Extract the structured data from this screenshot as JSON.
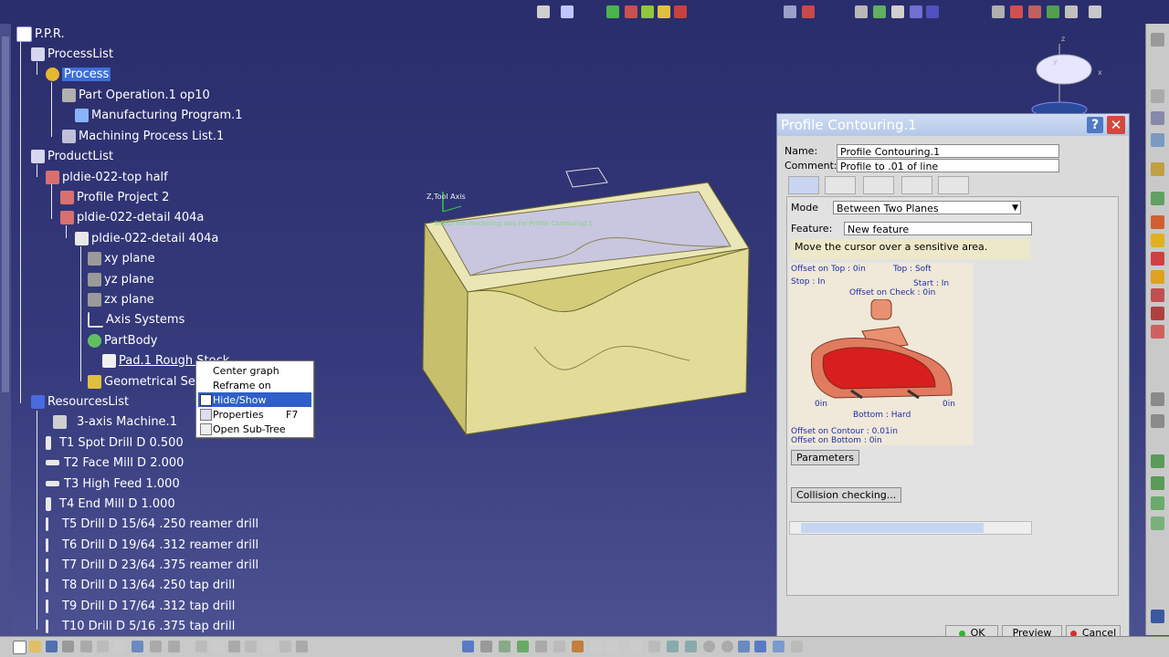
{
  "tree": {
    "root": "P.P.R.",
    "items": [
      {
        "label": "ProcessList"
      },
      {
        "label": "Process"
      },
      {
        "label": "Part Operation.1 op10"
      },
      {
        "label": "Manufacturing Program.1"
      },
      {
        "label": "Machining Process List.1"
      },
      {
        "label": "ProductList"
      },
      {
        "label": "pldie-022-top half"
      },
      {
        "label": "Profile Project 2"
      },
      {
        "label": "pldie-022-detail 404a"
      },
      {
        "label": "pldie-022-detail 404a"
      },
      {
        "label": "xy plane"
      },
      {
        "label": "yz plane"
      },
      {
        "label": "zx plane"
      },
      {
        "label": "Axis Systems"
      },
      {
        "label": "PartBody"
      },
      {
        "label": "Pad.1 Rough Stock"
      },
      {
        "label": "Geometrical Set"
      },
      {
        "label": "ResourcesList"
      },
      {
        "label": "3-axis Machine.1"
      },
      {
        "label": "T1 Spot Drill D 0.500"
      },
      {
        "label": "T2 Face Mill D 2.000"
      },
      {
        "label": "T3 High Feed 1.000"
      },
      {
        "label": "T4 End Mill D 1.000"
      },
      {
        "label": "T5 Drill D 15/64 .250 reamer drill"
      },
      {
        "label": "T6 Drill D 19/64 .312 reamer drill"
      },
      {
        "label": "T7 Drill D 23/64 .375 reamer drill"
      },
      {
        "label": "T8 Drill D 13/64 .250 tap drill"
      },
      {
        "label": "T9 Drill D 17/64 .312 tap drill"
      },
      {
        "label": "T10 Drill D 5/16 .375 tap drill"
      }
    ]
  },
  "context_menu": {
    "items": [
      {
        "label": "Center graph",
        "key": ""
      },
      {
        "label": "Reframe on",
        "key": ""
      },
      {
        "label": "Hide/Show",
        "key": ""
      },
      {
        "label": "Properties",
        "key": "F7"
      },
      {
        "label": "Open Sub-Tree",
        "key": ""
      }
    ]
  },
  "viewport": {
    "tool_axis_label": "Z,Tool Axis",
    "axis_note": "Select the machining axis for Profile Contouring.1",
    "compass_z": "z",
    "compass_x": "x",
    "compass_y": "y"
  },
  "dialog": {
    "title": "Profile Contouring.1",
    "help": "?",
    "close": "✕",
    "name_label": "Name:",
    "name_value": "Profile Contouring.1",
    "comment_label": "Comment:",
    "comment_value": "Profile to .01 of line",
    "mode_label": "Mode",
    "mode_value": "Between Two Planes",
    "feature_label": "Feature:",
    "feature_value": "New feature",
    "hint": "Move the cursor over a sensitive area.",
    "offset_top": "Offset on Top : 0in",
    "top": "Top : Soft",
    "stop": "Stop : In",
    "start": "Start : In",
    "offset_check": "Offset on Check : 0in",
    "left_0in": "0in",
    "right_0in": "0in",
    "bottom": "Bottom : Hard",
    "offset_contour": "Offset on Contour : 0.01in",
    "offset_bottom": "Offset on Bottom : 0in",
    "parameters": "Parameters",
    "collision": "Collision checking...",
    "ok": "OK",
    "preview": "Preview",
    "cancel": "Cancel"
  },
  "colors": {
    "background": "#2b2d6a",
    "tree_text": "#ffffff",
    "selection": "#3d6fd8",
    "dialog_title": "#b5c8ea",
    "part_face": "#d8d07a",
    "diagram_red": "#d81e1e"
  }
}
